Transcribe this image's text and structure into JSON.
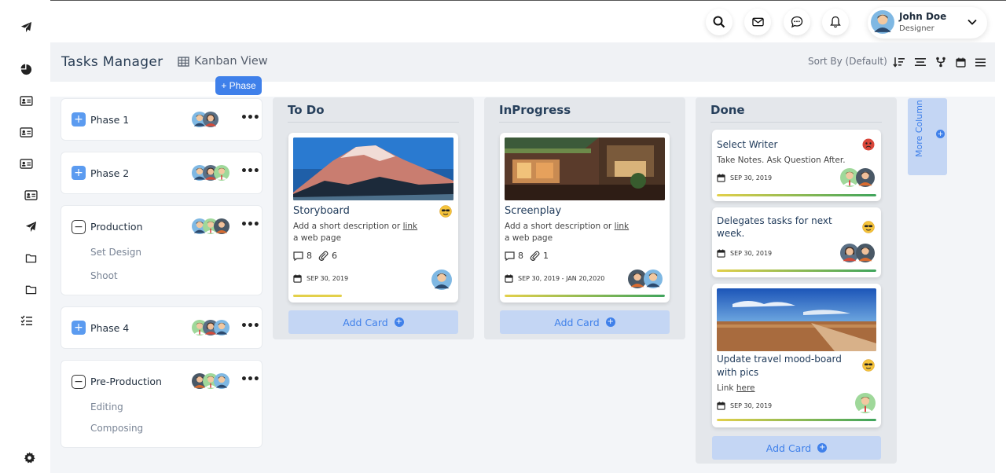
{
  "app": {
    "title": "Tasks Manager",
    "view_label": "Kanban View",
    "sort_label": "Sort By (Default)",
    "add_phase": "+ Phase"
  },
  "user": {
    "name": "John Doe",
    "role": "Designer"
  },
  "header_icons": [
    "search-icon",
    "mail-icon",
    "chat-icon",
    "bell-icon"
  ],
  "sidebar_icons": [
    "paper-plane-icon",
    "pie-chart-icon",
    "id-card-icon",
    "id-card-icon",
    "id-card-icon",
    "id-card-icon",
    "paper-plane-icon",
    "folder-icon",
    "folder-icon",
    "checklist-icon",
    "gear-icon"
  ],
  "toolbar_icons": [
    "sort-desc-icon",
    "align-icon",
    "fork-icon",
    "calendar-icon",
    "menu-icon"
  ],
  "phases": [
    {
      "name": "Phase 1",
      "expanded": false,
      "subs": []
    },
    {
      "name": "Phase 2",
      "expanded": false,
      "subs": []
    },
    {
      "name": "Production",
      "expanded": true,
      "subs": [
        "Set Design",
        "Shoot"
      ]
    },
    {
      "name": "Phase 4",
      "expanded": false,
      "subs": []
    },
    {
      "name": "Pre-Production",
      "expanded": true,
      "subs": [
        "Editing",
        "Composing"
      ]
    }
  ],
  "columns": [
    {
      "title": "To Do",
      "add": "Add Card",
      "cards": [
        {
          "title": "Storyboard",
          "desc": "Add a short description or ",
          "link": "link",
          "desc2": "a web page",
          "comments": "8",
          "attachments": "6",
          "date": "SEP 30, 2019",
          "progress": 0.3
        }
      ]
    },
    {
      "title": "InProgress",
      "add": "Add Card",
      "cards": [
        {
          "title": "Screenplay",
          "desc": "Add a short description or ",
          "link": "link",
          "desc2": "a web page",
          "comments": "8",
          "attachments": "1",
          "date": "SEP 30, 2019 - JAN 20,2020",
          "progress": 1.0
        }
      ]
    },
    {
      "title": "Done",
      "add": "Add Card",
      "cards": [
        {
          "title": "Select Writer",
          "desc": "Take Notes. Ask Question After.",
          "date": "SEP 30, 2019",
          "progress": 1.0
        },
        {
          "title": "Delegates tasks for next week.",
          "date": "SEP 30, 2019",
          "progress": 1.0
        },
        {
          "title": "Update travel mood-board with pics",
          "desc": "Link ",
          "link": "here",
          "date": "SEP 30, 2019",
          "progress": 1.0
        }
      ]
    }
  ],
  "more_column": "More Column",
  "colors": {
    "accent": "#3f80ea",
    "add_card_bg": "#c4d6f4",
    "column_bg": "#e4e7eb",
    "progress_start": "#e3d04a",
    "progress_end": "#3fa45c"
  }
}
